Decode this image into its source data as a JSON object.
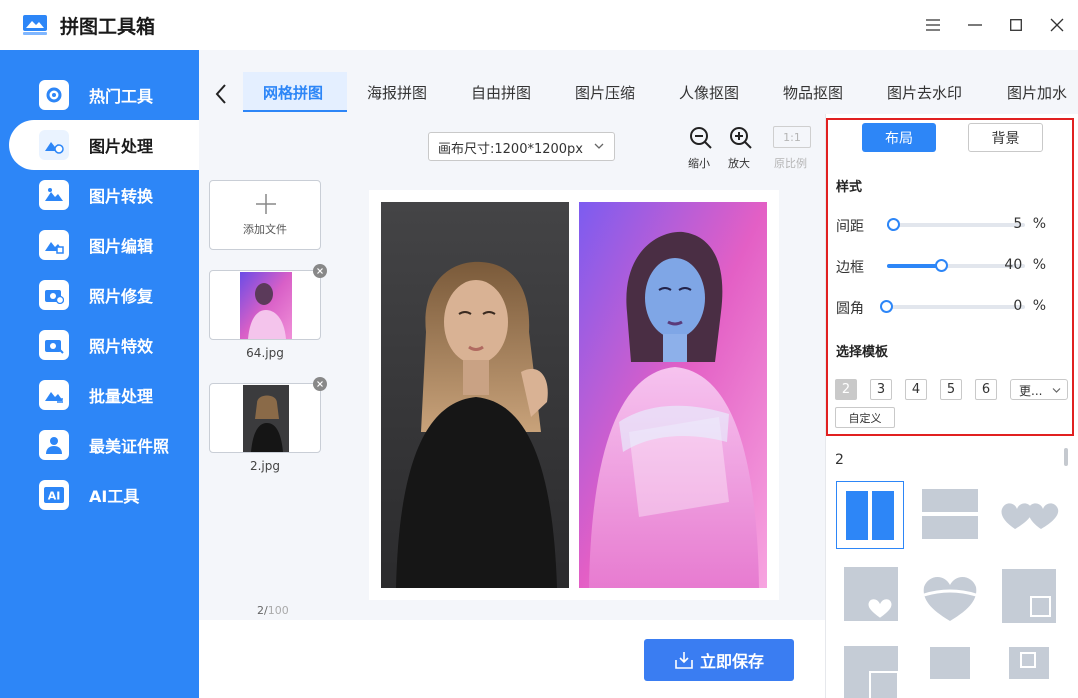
{
  "app": {
    "title": "拼图工具箱"
  },
  "sidebar": {
    "items": [
      {
        "label": "热门工具",
        "icon": "tools-icon"
      },
      {
        "label": "图片处理",
        "icon": "image-process-icon"
      },
      {
        "label": "图片转换",
        "icon": "image-convert-icon"
      },
      {
        "label": "图片编辑",
        "icon": "image-edit-icon"
      },
      {
        "label": "照片修复",
        "icon": "camera-repair-icon"
      },
      {
        "label": "照片特效",
        "icon": "camera-effect-icon"
      },
      {
        "label": "批量处理",
        "icon": "batch-icon"
      },
      {
        "label": "最美证件照",
        "icon": "id-photo-icon"
      },
      {
        "label": "AI工具",
        "icon": "ai-icon"
      }
    ],
    "active_index": 1
  },
  "tabs": [
    "网格拼图",
    "海报拼图",
    "自由拼图",
    "图片压缩",
    "人像抠图",
    "物品抠图",
    "图片去水印",
    "图片加水"
  ],
  "toolbar": {
    "canvas_size": "画布尺寸:1200*1200px",
    "zoom_out": "缩小",
    "zoom_in": "放大",
    "ratio_button": "1:1",
    "ratio_label": "原比例"
  },
  "files": {
    "add_label": "添加文件",
    "items": [
      {
        "name": "64.jpg"
      },
      {
        "name": "2.jpg"
      }
    ],
    "count": "2/",
    "count_total": "100"
  },
  "save_button": "立即保存",
  "panel": {
    "segment_layout": "布局",
    "segment_background": "背景",
    "style_title": "样式",
    "sliders": [
      {
        "label": "间距",
        "value": 5,
        "unit": "%"
      },
      {
        "label": "边框",
        "value": 40,
        "unit": "%"
      },
      {
        "label": "圆角",
        "value": 0,
        "unit": "%"
      }
    ],
    "template_title": "选择模板",
    "templates": [
      "2",
      "3",
      "4",
      "5",
      "6"
    ],
    "selected_template": "2",
    "more": "更...",
    "custom": "自定义",
    "layout_count": "2"
  },
  "colors": {
    "accent": "#2d86f7",
    "save_button": "#3a7df2",
    "highlight_box": "#e12020"
  }
}
